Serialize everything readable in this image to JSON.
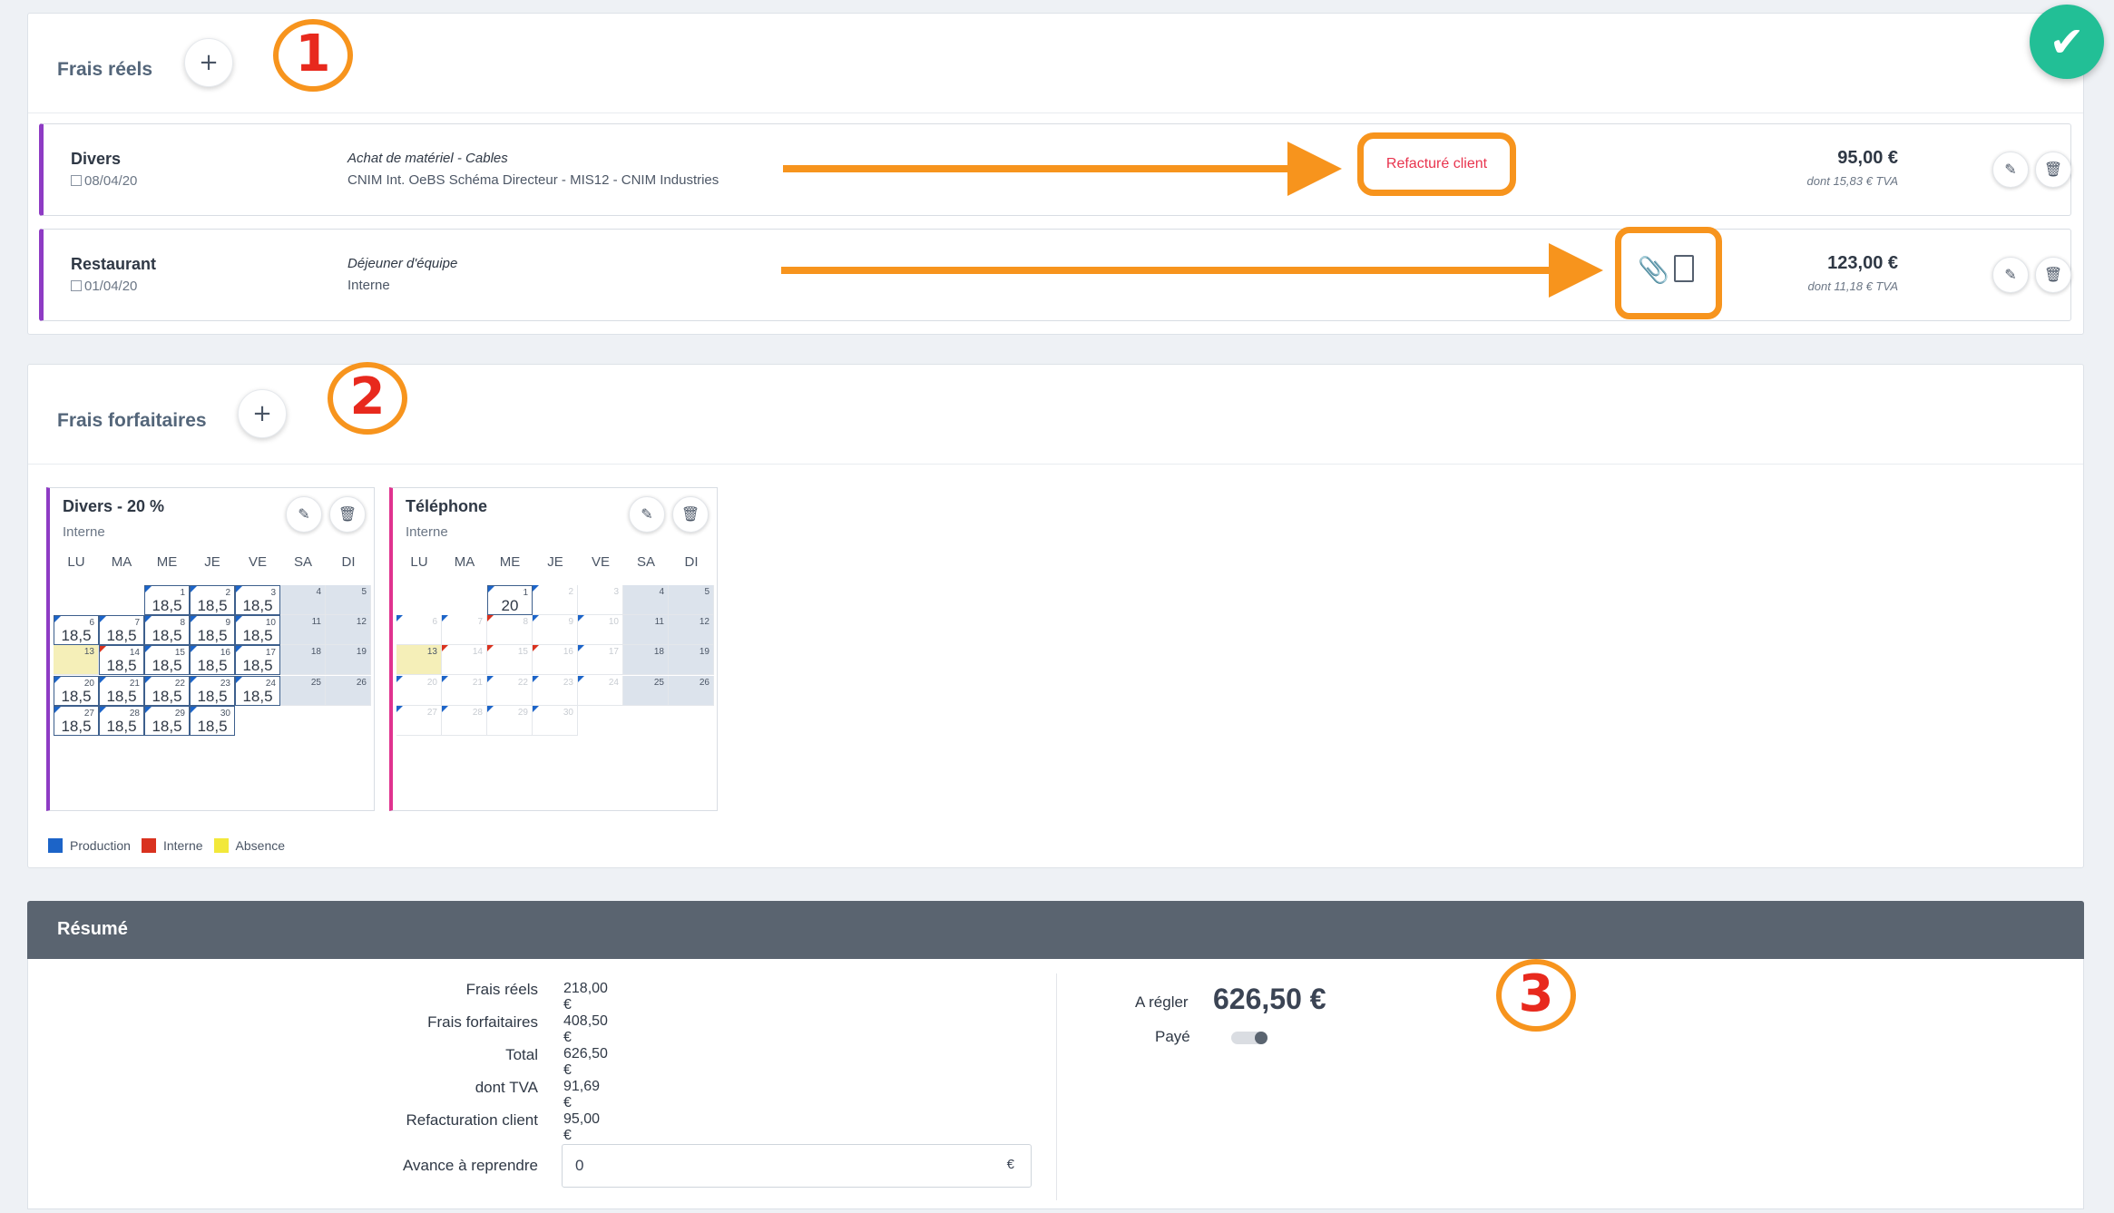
{
  "frais_reels": {
    "title": "Frais réels",
    "add_label": "+",
    "badge": "1",
    "items": [
      {
        "category": "Divers",
        "date": "08/04/20",
        "description": "Achat de matériel - Cables",
        "project": "CNIM Int. OeBS Schéma Directeur - MIS12 - CNIM Industries",
        "tag": "Refacturé client",
        "amount": "95,00 €",
        "tva": "dont 15,83 € TVA"
      },
      {
        "category": "Restaurant",
        "date": "01/04/20",
        "description": "Déjeuner d'équipe",
        "project": "Interne",
        "amount": "123,00 €",
        "tva": "dont 11,18 € TVA"
      }
    ]
  },
  "frais_forfaitaires": {
    "title": "Frais forfaitaires",
    "add_label": "+",
    "badge": "2",
    "weekdays": [
      "LU",
      "MA",
      "ME",
      "JE",
      "VE",
      "SA",
      "DI"
    ],
    "calendars": [
      {
        "title": "Divers - 20 %",
        "subtitle": "Interne",
        "accent": "#8e3bc4",
        "days": [
          {
            "d": "1",
            "v": "18,5",
            "m": "blue"
          },
          {
            "d": "2",
            "v": "18,5",
            "m": "blue"
          },
          {
            "d": "3",
            "v": "18,5",
            "m": "blue"
          },
          {
            "d": "4",
            "we": true
          },
          {
            "d": "5",
            "we": true
          },
          {
            "d": "6",
            "v": "18,5",
            "m": "blue"
          },
          {
            "d": "7",
            "v": "18,5",
            "m": "blue"
          },
          {
            "d": "8",
            "v": "18,5",
            "m": "blue"
          },
          {
            "d": "9",
            "v": "18,5",
            "m": "blue"
          },
          {
            "d": "10",
            "v": "18,5",
            "m": "blue"
          },
          {
            "d": "11",
            "we": true
          },
          {
            "d": "12",
            "we": true
          },
          {
            "d": "13",
            "abs": true
          },
          {
            "d": "14",
            "v": "18,5",
            "m": "red"
          },
          {
            "d": "15",
            "v": "18,5",
            "m": "blue"
          },
          {
            "d": "16",
            "v": "18,5",
            "m": "blue"
          },
          {
            "d": "17",
            "v": "18,5",
            "m": "blue"
          },
          {
            "d": "18",
            "we": true
          },
          {
            "d": "19",
            "we": true
          },
          {
            "d": "20",
            "v": "18,5",
            "m": "blue"
          },
          {
            "d": "21",
            "v": "18,5",
            "m": "blue"
          },
          {
            "d": "22",
            "v": "18,5",
            "m": "blue"
          },
          {
            "d": "23",
            "v": "18,5",
            "m": "blue"
          },
          {
            "d": "24",
            "v": "18,5",
            "m": "blue"
          },
          {
            "d": "25",
            "we": true
          },
          {
            "d": "26",
            "we": true
          },
          {
            "d": "27",
            "v": "18,5",
            "m": "blue"
          },
          {
            "d": "28",
            "v": "18,5",
            "m": "blue"
          },
          {
            "d": "29",
            "v": "18,5",
            "m": "blue"
          },
          {
            "d": "30",
            "v": "18,5",
            "m": "blue"
          }
        ]
      },
      {
        "title": "Téléphone",
        "subtitle": "Interne",
        "accent": "#e0338f",
        "days": [
          {
            "d": "1",
            "v": "20",
            "m": "blue"
          },
          {
            "d": "2",
            "m": "blue",
            "faint": true
          },
          {
            "d": "3",
            "faint": true
          },
          {
            "d": "4",
            "we": true
          },
          {
            "d": "5",
            "we": true
          },
          {
            "d": "6",
            "m": "blue",
            "faint": true
          },
          {
            "d": "7",
            "m": "blue",
            "faint": true
          },
          {
            "d": "8",
            "m": "red",
            "faint": true
          },
          {
            "d": "9",
            "m": "blue",
            "faint": true
          },
          {
            "d": "10",
            "m": "blue",
            "faint": true
          },
          {
            "d": "11",
            "we": true
          },
          {
            "d": "12",
            "we": true
          },
          {
            "d": "13",
            "abs": true
          },
          {
            "d": "14",
            "m": "red",
            "faint": true
          },
          {
            "d": "15",
            "m": "red",
            "faint": true
          },
          {
            "d": "16",
            "m": "red",
            "faint": true
          },
          {
            "d": "17",
            "m": "blue",
            "faint": true
          },
          {
            "d": "18",
            "we": true
          },
          {
            "d": "19",
            "we": true
          },
          {
            "d": "20",
            "m": "blue",
            "faint": true
          },
          {
            "d": "21",
            "m": "blue",
            "faint": true
          },
          {
            "d": "22",
            "m": "blue",
            "faint": true
          },
          {
            "d": "23",
            "m": "blue",
            "faint": true
          },
          {
            "d": "24",
            "m": "blue",
            "faint": true
          },
          {
            "d": "25",
            "we": true
          },
          {
            "d": "26",
            "we": true
          },
          {
            "d": "27",
            "m": "blue",
            "faint": true
          },
          {
            "d": "28",
            "m": "blue",
            "faint": true
          },
          {
            "d": "29",
            "m": "blue",
            "faint": true
          },
          {
            "d": "30",
            "m": "blue",
            "faint": true
          }
        ]
      }
    ],
    "legend": [
      {
        "label": "Production",
        "color": "#1c64c8"
      },
      {
        "label": "Interne",
        "color": "#d9321f"
      },
      {
        "label": "Absence",
        "color": "#f2e83a"
      }
    ]
  },
  "resume": {
    "title": "Résumé",
    "badge": "3",
    "rows": [
      {
        "label": "Frais réels",
        "value": "218,00 €"
      },
      {
        "label": "Frais forfaitaires",
        "value": "408,50 €"
      },
      {
        "label": "Total",
        "value": "626,50 €"
      },
      {
        "label": "dont TVA",
        "value": "91,69 €"
      },
      {
        "label": "Refacturation client",
        "value": "95,00 €"
      }
    ],
    "advance_label": "Avance à reprendre",
    "advance_value": "0",
    "advance_unit": "€",
    "a_regler_label": "A régler",
    "a_regler_value": "626,50 €",
    "paye_label": "Payé"
  },
  "icons": {
    "check": "check-icon",
    "edit": "pencil-icon",
    "delete": "trash-icon",
    "attach": "paperclip-icon",
    "file": "file-image-icon",
    "calendar": "calendar-icon"
  }
}
